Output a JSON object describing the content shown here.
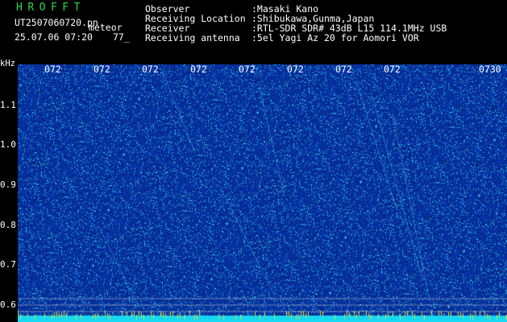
{
  "header": {
    "brand": "HROFFT",
    "filename": "UT2507060720.pn",
    "tag": "meteor",
    "datetime": "25.07.06 07:20",
    "value": "77_",
    "fields": [
      {
        "label": "Observer",
        "value": ":Masaki Kano"
      },
      {
        "label": "Receiving Location",
        "value": ":Shibukawa,Gunma,Japan"
      },
      {
        "label": "Receiver",
        "value": ":RTL-SDR SDR# 43dB L15 114.1MHz USB"
      },
      {
        "label": "Receiving antenna",
        "value": ":5el Yagi Az 20 for Aomori VOR"
      }
    ]
  },
  "axis": {
    "unit": "kHz",
    "time_ticks": [
      "072",
      "072",
      "072",
      "072",
      "072",
      "072",
      "072",
      "072",
      "0730"
    ],
    "freq_ticks": [
      "1.1",
      "1.0",
      "0.9",
      "0.8",
      "0.7",
      "0.6"
    ]
  },
  "colors": {
    "background": "#000000",
    "noise_base": "#0a2a9c",
    "brand": "#2bd84a",
    "text": "#ffffff",
    "signal_band": "#16d8f0",
    "echo": "#4fe8ff"
  }
}
